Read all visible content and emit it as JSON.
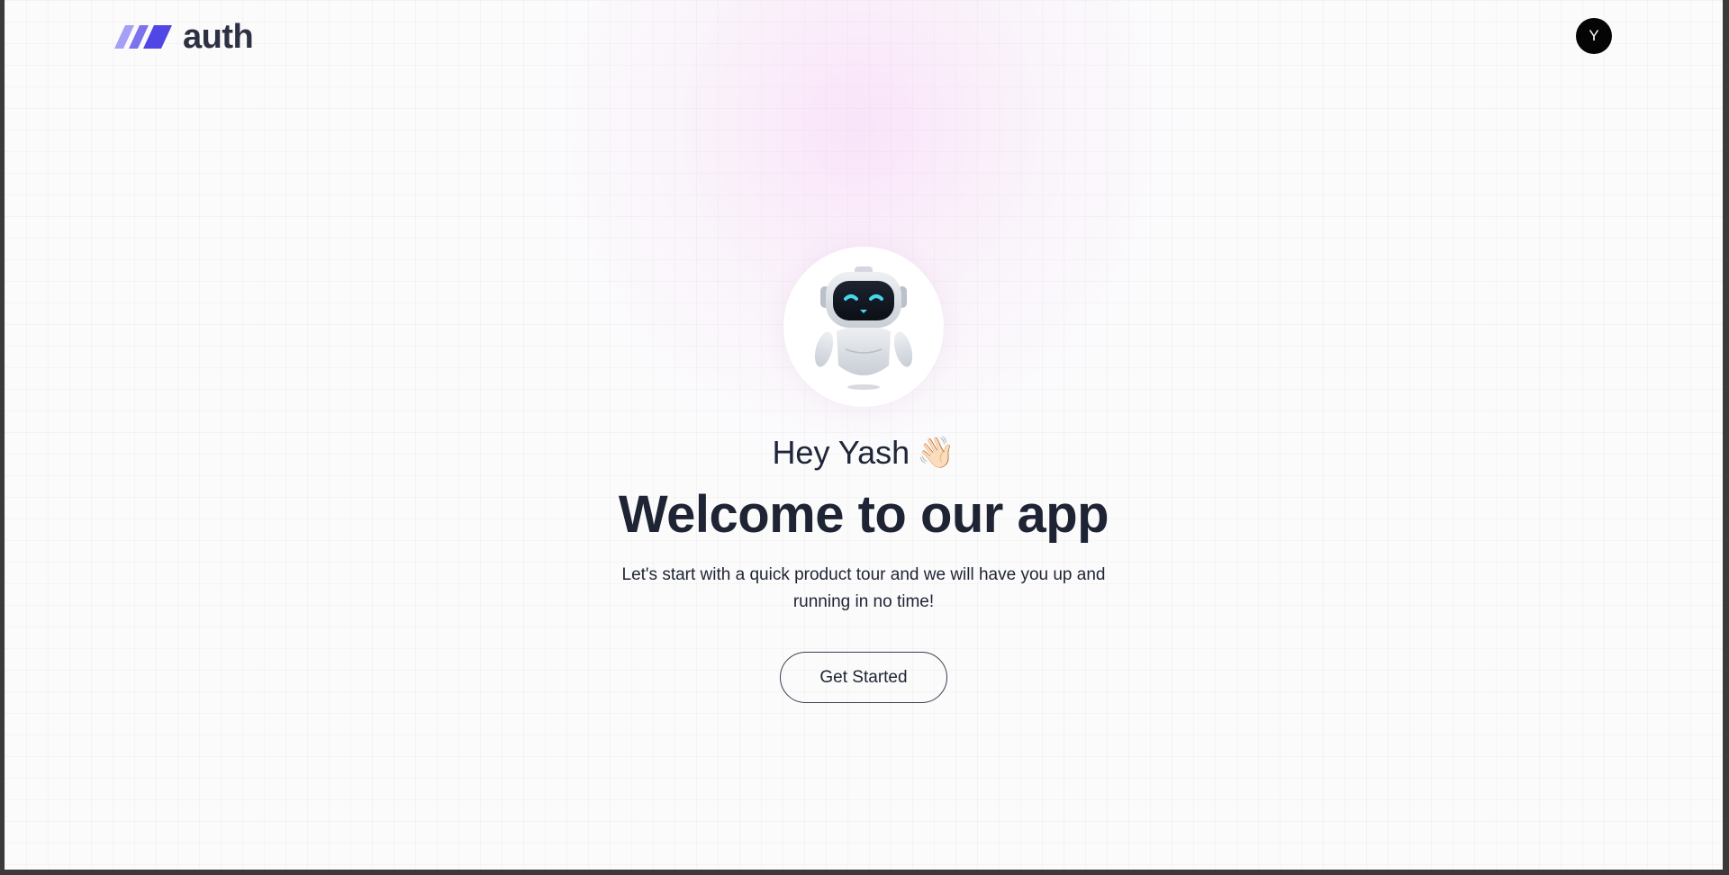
{
  "header": {
    "logo_text": "auth",
    "avatar_initial": "Y"
  },
  "hero": {
    "greeting": "Hey Yash",
    "wave_emoji": "👋🏻",
    "title": "Welcome to our app",
    "subtitle": "Let's start with a quick product tour and we will have you up and running in no time!",
    "cta_label": "Get Started",
    "illustration": "robot-icon"
  },
  "colors": {
    "logo_accent": "#4f46e5",
    "text_dark": "#1e2433",
    "glow": "#f7c8f5"
  }
}
